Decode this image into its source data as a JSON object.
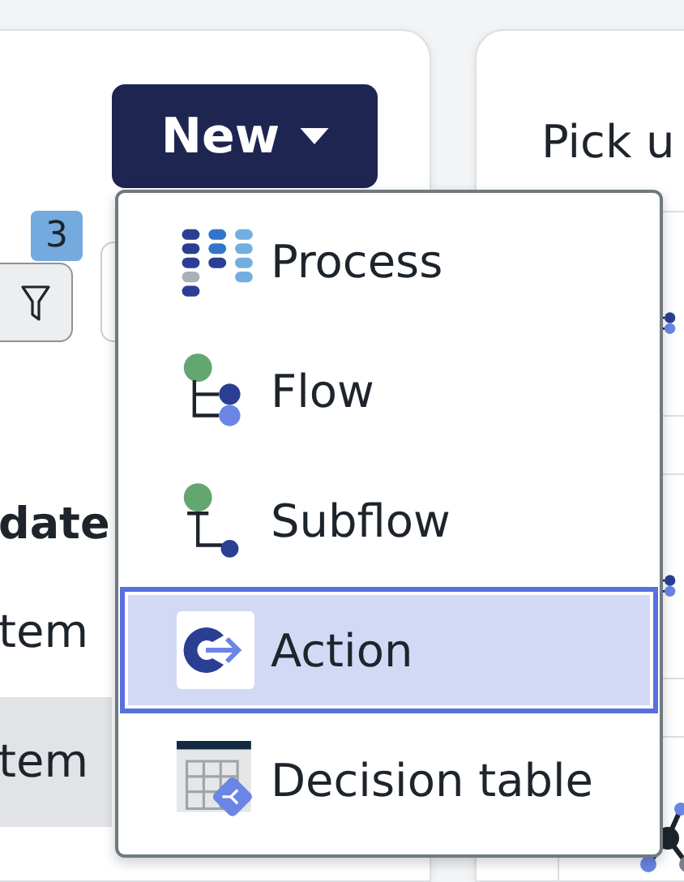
{
  "new_button": {
    "label": "New"
  },
  "filter": {
    "badge": "3"
  },
  "table": {
    "header": "date",
    "rows": [
      {
        "cell": "tem",
        "highlighted": false
      },
      {
        "cell": "tem",
        "highlighted": true
      }
    ]
  },
  "right_panel": {
    "title": "Pick u",
    "cards": [
      {
        "kind": "flow"
      },
      {
        "kind": "flow"
      },
      {
        "kind": "network"
      }
    ]
  },
  "menu": {
    "items": [
      {
        "label": "Process",
        "kind": "process",
        "selected": false
      },
      {
        "label": "Flow",
        "kind": "flow",
        "selected": false
      },
      {
        "label": "Subflow",
        "kind": "subflow",
        "selected": false
      },
      {
        "label": "Action",
        "kind": "action",
        "selected": true
      },
      {
        "label": "Decision table",
        "kind": "decision",
        "selected": false
      }
    ]
  }
}
